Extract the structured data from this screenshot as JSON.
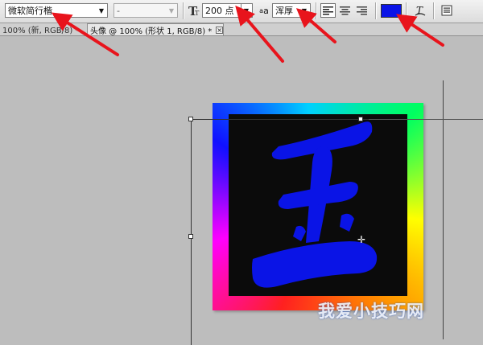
{
  "options_bar": {
    "font_family": "微软简行楷",
    "font_style": "-",
    "font_size": "200 点",
    "antialias_label": "aa",
    "antialias_method": "浑厚",
    "text_color": "#0a14e6"
  },
  "tabs": [
    {
      "label": "100% (新, RGB/8) *"
    },
    {
      "label": "头像 @ 100% (形状 1, RGB/8) *"
    }
  ],
  "canvas": {
    "character": "王",
    "character_color": "#0a14e6",
    "watermark": "我爱小技巧网"
  },
  "annotation_color": "#e8141c"
}
